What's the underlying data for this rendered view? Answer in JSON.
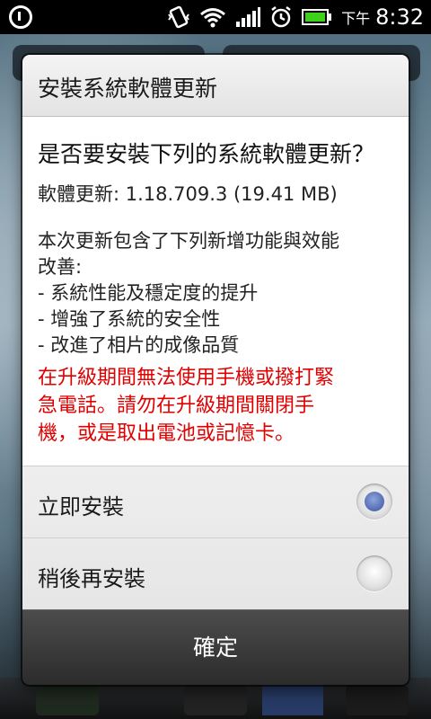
{
  "status_bar": {
    "ampm": "下午",
    "time": "8:32",
    "icons": [
      "download-icon",
      "vibrate-icon",
      "wifi-icon",
      "signal-icon",
      "alarm-icon",
      "battery-icon"
    ]
  },
  "dialog": {
    "title": "安裝系統軟體更新",
    "question": "是否要安裝下列的系統軟體更新？",
    "version": "軟體更新: 1.18.709.3 (19.41 MB)",
    "description_lines": [
      "本次更新包含了下列新增功能與效能",
      "改善:",
      "- 系統性能及穩定度的提升",
      "- 增強了系統的安全性",
      "- 改進了相片的成像品質"
    ],
    "warning_lines": [
      "在升級期間無法使用手機或撥打緊",
      "急電話。請勿在升級期間關閉手",
      "機，或是取出電池或記憶卡。"
    ],
    "warning_color": "#e00000",
    "options": [
      {
        "label": "立即安裝",
        "selected": true
      },
      {
        "label": "稍後再安裝",
        "selected": false
      }
    ],
    "ok_label": "確定"
  },
  "colors": {
    "radio_selected": "#5a72b8",
    "footer": "#3a3a3a"
  }
}
